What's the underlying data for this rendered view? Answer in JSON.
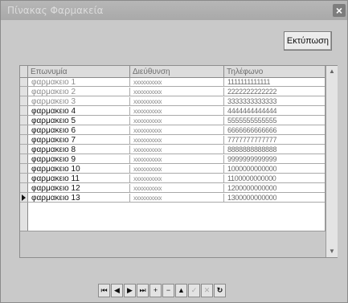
{
  "window": {
    "title": "Πίνακας Φαρμακεία"
  },
  "toolbar": {
    "print_label": "Εκτύπωση"
  },
  "grid": {
    "columns": [
      "Επωνυμία",
      "Διεύθυνση",
      "Τηλέφωνο"
    ],
    "rows": [
      [
        "φαρμακειο 1",
        "xxxxxxxxxx",
        "1111111111111"
      ],
      [
        "φαρμακειο 2",
        "xxxxxxxxxx",
        "2222222222222"
      ],
      [
        "φαρμακειο 3",
        "xxxxxxxxxx",
        "3333333333333"
      ],
      [
        "φαρμακειο 4",
        "xxxxxxxxxx",
        "4444444444444"
      ],
      [
        "φαρμακειο 5",
        "xxxxxxxxxx",
        "5555555555555"
      ],
      [
        "φαρμακειο 6",
        "xxxxxxxxxx",
        "6666666666666"
      ],
      [
        "φαρμακειο 7",
        "xxxxxxxxxx",
        "7777777777777"
      ],
      [
        "φαρμακειο 8",
        "xxxxxxxxxx",
        "8888888888888"
      ],
      [
        "φαρμακειο 9",
        "xxxxxxxxxx",
        "9999999999999"
      ],
      [
        "φαρμακειο 10",
        "xxxxxxxxxx",
        "1000000000000"
      ],
      [
        "φαρμακειο 11",
        "xxxxxxxxxx",
        "1100000000000"
      ],
      [
        "φαρμακειο 12",
        "xxxxxxxxxx",
        "1200000000000"
      ],
      [
        "φαρμακειο 13",
        "xxxxxxxxxx",
        "1300000000000"
      ]
    ],
    "current_row_index": 12
  },
  "navigator": {
    "buttons": [
      {
        "name": "first-record-button",
        "glyph": "⏮",
        "icon": "first-icon",
        "enabled": true
      },
      {
        "name": "prior-record-button",
        "glyph": "◀",
        "icon": "prior-icon",
        "enabled": true
      },
      {
        "name": "next-record-button",
        "glyph": "▶",
        "icon": "next-icon",
        "enabled": true
      },
      {
        "name": "last-record-button",
        "glyph": "⏭",
        "icon": "last-icon",
        "enabled": true
      },
      {
        "name": "insert-record-button",
        "glyph": "+",
        "icon": "plus-icon",
        "enabled": true
      },
      {
        "name": "delete-record-button",
        "glyph": "−",
        "icon": "minus-icon",
        "enabled": true
      },
      {
        "name": "edit-record-button",
        "glyph": "▲",
        "icon": "edit-icon",
        "enabled": true
      },
      {
        "name": "post-record-button",
        "glyph": "✓",
        "icon": "check-icon",
        "enabled": false
      },
      {
        "name": "cancel-record-button",
        "glyph": "✕",
        "icon": "cancel-icon",
        "enabled": false
      },
      {
        "name": "refresh-button",
        "glyph": "↻",
        "icon": "refresh-icon",
        "enabled": true
      }
    ]
  }
}
